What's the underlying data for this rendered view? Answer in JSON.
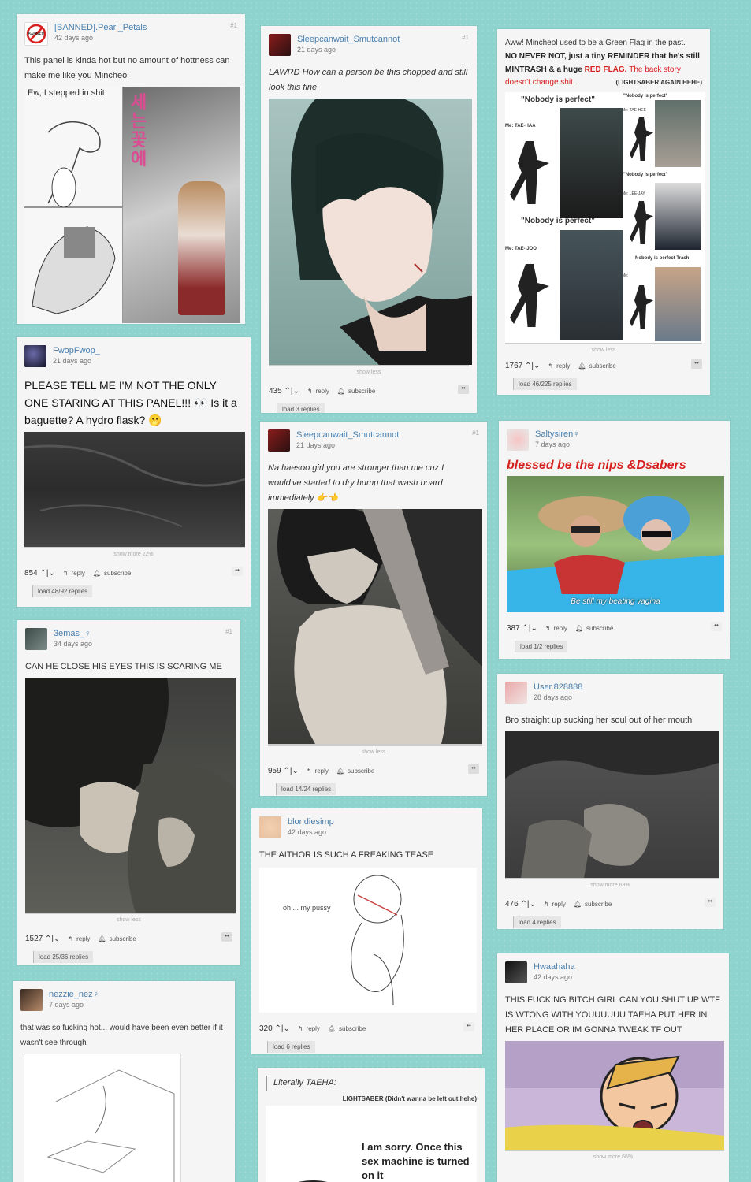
{
  "posts": [
    {
      "user": "[BANNED].Pearl_Petals",
      "ago": "42 days ago",
      "pin": "#1",
      "text": "This panel is kinda hot but no amount of hottness can make me like you Mincheol",
      "img_text": "Ew, I stepped in shit."
    },
    {
      "user": "Sleepcanwait_Smutcannot",
      "ago": "21 days ago",
      "pin": "#1",
      "text": "LAWRD How can a person be this chopped and still look this fine",
      "caption": "show less",
      "votes": "435",
      "load": "load 3 replies"
    },
    {
      "intro": "Aww! Mincheol used to be a Green Flag in the past.",
      "line1": "NO NEVER NOT, just a tiny REMINDER that he's still MINTRASH & a huge",
      "redflag": "RED FLAG.",
      "line2": "The back story",
      "line3": "doesn't change shit.",
      "sig": "(LIGHTSABER AGAIN HEHE)",
      "np": "\"Nobody is perfect\"",
      "np_small": "\"Nobody is perfect\"",
      "np_trash": "Nobody is perfect Trash",
      "me1": "Me: TAE-HAA",
      "me2": "Me: TAE- JOO",
      "me_s1": "Me: TAE-HEE",
      "me_s2": "Me: LEE-JAY",
      "me_s3": "Me:",
      "caption": "show less",
      "votes": "1767",
      "load": "load 46/225 replies"
    },
    {
      "user": "FwopFwop_",
      "ago": "21 days ago",
      "text": "PLEASE TELL ME I'M NOT THE ONLY ONE STARING AT THIS PANEL!!! 👀 Is it a baguette? A hydro flask? 🫢",
      "caption": "show more 22%",
      "votes": "854",
      "load": "load 48/92 replies"
    },
    {
      "user": "Sleepcanwait_Smutcannot",
      "ago": "21 days ago",
      "pin": "#1",
      "text": "Na haesoo girl you are stronger than me cuz I would've started to dry hump that wash board immediately 👉👈",
      "caption": "show less",
      "votes": "959",
      "load": "load 14/24 replies"
    },
    {
      "user": "Saltysiren♀",
      "ago": "7 days ago",
      "text": "blessed be the nips &Dsabers",
      "img_text": "Be still my beating vagina",
      "votes": "387",
      "load": "load 1/2 replies"
    },
    {
      "user": "3emas_♀",
      "ago": "34 days ago",
      "pin": "#1",
      "text": "CAN HE CLOSE HIS EYES THIS IS SCARING ME",
      "caption": "show less",
      "votes": "1527",
      "load": "load 25/36 replies"
    },
    {
      "user": "User.828888",
      "ago": "28 days ago",
      "text": "Bro straight up sucking her soul out of her mouth",
      "caption": "show more 63%",
      "votes": "476",
      "load": "load 4 replies"
    },
    {
      "user": "blondiesimp",
      "ago": "42 days ago",
      "text": "THE AITHOR IS SUCH A FREAKING TEASE",
      "img_text": "oh ... my pussy",
      "votes": "320",
      "load": "load 6 replies"
    },
    {
      "user": "nezzie_nez♀",
      "ago": "7 days ago",
      "text": "that was so fucking hot... would have been even better if it wasn't see through"
    },
    {
      "text": "Literally TAEHA:",
      "sig": "LIGHTSABER (Didn't wanna be left out hehe)",
      "img_text": "I am sorry. Once this sex machine is turned on it"
    },
    {
      "user": "Hwaahaha",
      "ago": "42 days ago",
      "text": "THIS FUCKING BITCH GIRL CAN YOU SHUT UP WTF IS WTONG WITH YOUUUUUU TAEHA PUT HER IN HER PLACE OR IM GONNA TWEAK TF OUT",
      "caption": "show more 66%"
    }
  ],
  "ui": {
    "reply": "reply",
    "subscribe": "subscribe",
    "more": "••",
    "banned": "BANNED"
  }
}
